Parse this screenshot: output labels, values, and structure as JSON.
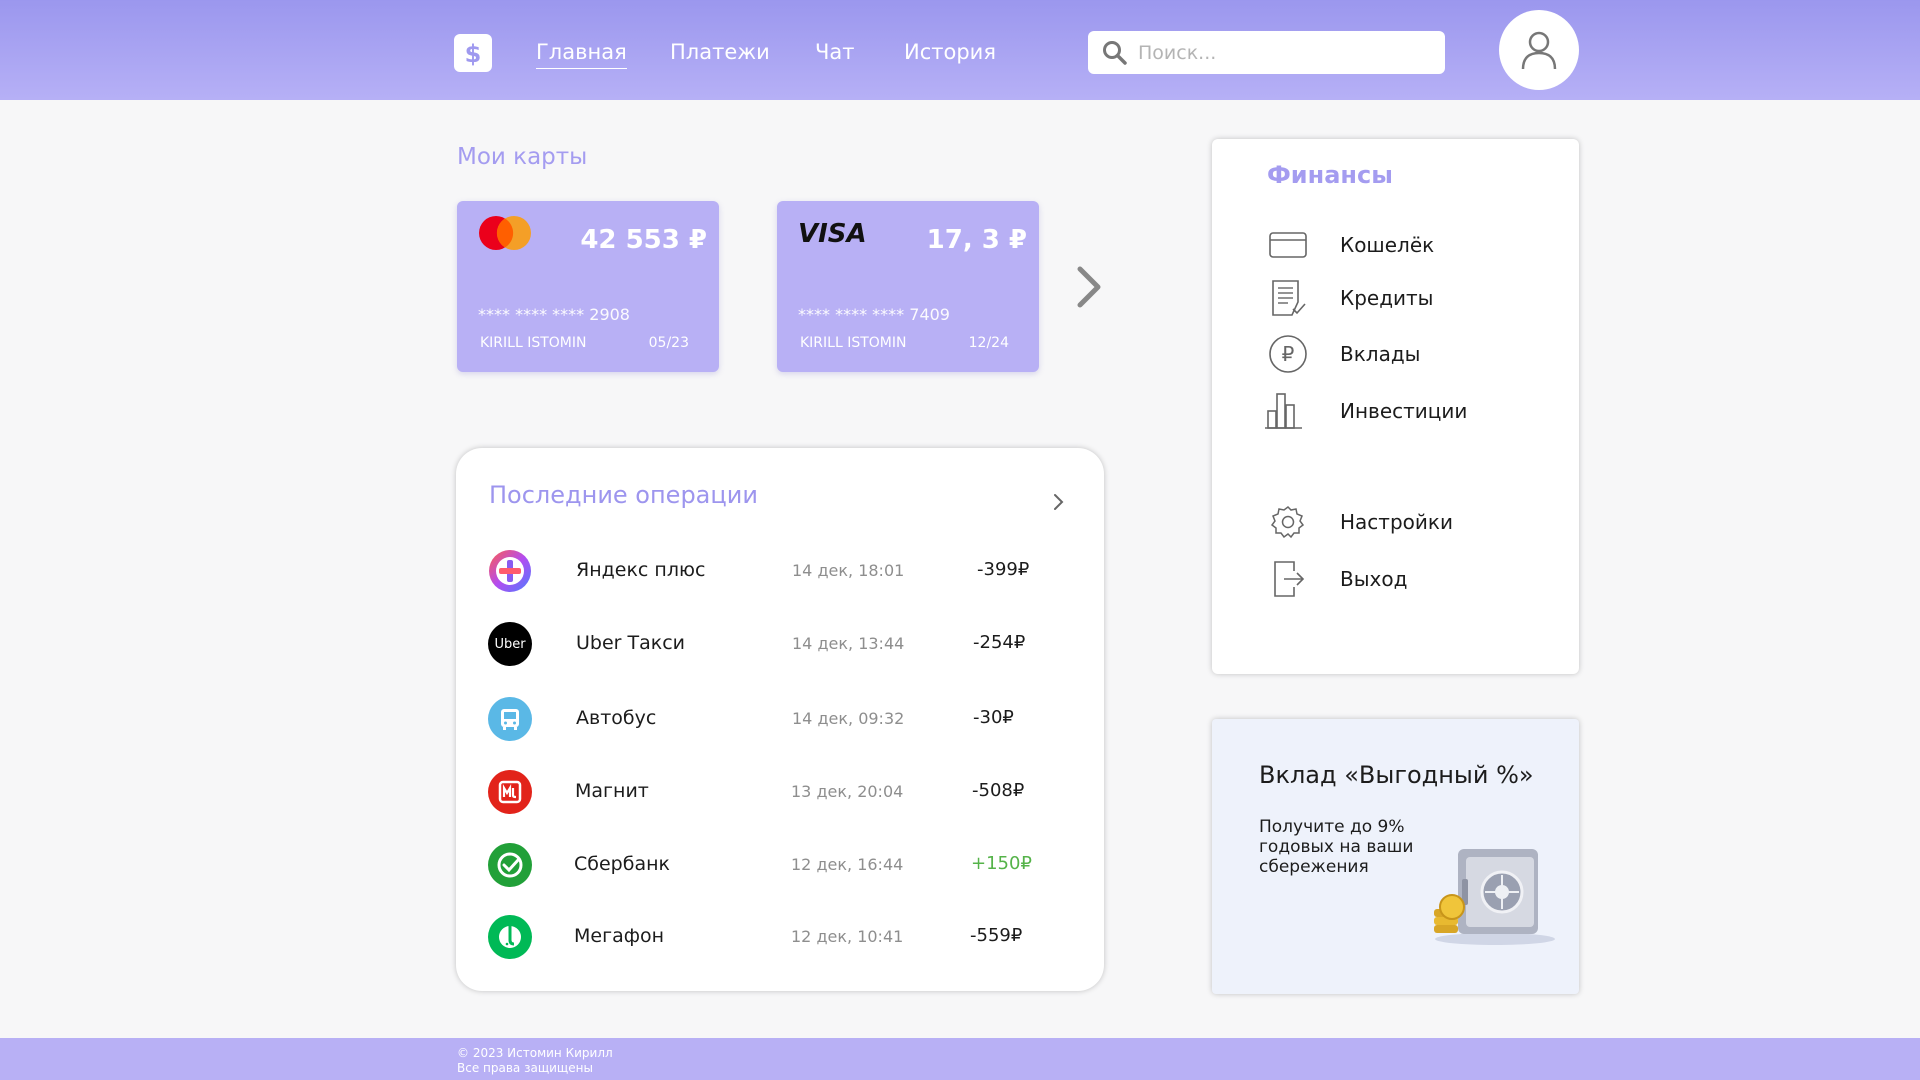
{
  "nav": {
    "items": [
      {
        "label": "Главная",
        "active": true
      },
      {
        "label": "Платежи"
      },
      {
        "label": "Чат"
      },
      {
        "label": "История"
      }
    ],
    "search_placeholder": "Поиск..."
  },
  "cards": {
    "title": "Мои карты",
    "items": [
      {
        "brand": "mastercard",
        "balance": "42 553 ₽",
        "number": "**** **** **** 2908",
        "holder": "KIRILL ISTOMIN",
        "expiry": "05/23"
      },
      {
        "brand": "VISA",
        "balance": "17, 3 ₽",
        "number": "**** **** **** 7409",
        "holder": "KIRILL ISTOMIN",
        "expiry": "12/24"
      }
    ]
  },
  "operations": {
    "title": "Последние операции",
    "rows": [
      {
        "name": "Яндекс плюс",
        "date": "14 дек, 18:01",
        "amount": "-399₽",
        "icon": "yandex-plus-icon"
      },
      {
        "name": "Uber Такси",
        "date": "14 дек, 13:44",
        "amount": "-254₽",
        "icon": "uber-icon"
      },
      {
        "name": "Автобус",
        "date": "14 дек, 09:32",
        "amount": "-30₽",
        "icon": "bus-icon"
      },
      {
        "name": "Магнит",
        "date": "13 дек, 20:04",
        "amount": "-508₽",
        "icon": "magnit-icon"
      },
      {
        "name": "Сбербанк",
        "date": "12 дек, 16:44",
        "amount": "+150₽",
        "icon": "sberbank-icon"
      },
      {
        "name": "Мегафон",
        "date": "12 дек, 10:41",
        "amount": "-559₽",
        "icon": "megafon-icon"
      }
    ]
  },
  "finances": {
    "title": "Финансы",
    "items": [
      {
        "label": "Кошелёк",
        "icon": "wallet-icon"
      },
      {
        "label": "Кредиты",
        "icon": "credits-icon"
      },
      {
        "label": "Вклады",
        "icon": "deposits-icon"
      },
      {
        "label": "Инвестиции",
        "icon": "investments-icon"
      },
      {
        "label": "Настройки",
        "icon": "settings-icon"
      },
      {
        "label": "Выход",
        "icon": "logout-icon"
      }
    ]
  },
  "promo": {
    "title": "Вклад «Выгодный %»",
    "text": "Получите до 9% годовых на ваши сбережения"
  },
  "footer": {
    "copyright": "© 2023 Истомин Кирилл",
    "rights": "Все права защищены"
  },
  "colors": {
    "accent": "#a49cf0",
    "card": "#b8b0f5",
    "positive": "#55b349"
  }
}
